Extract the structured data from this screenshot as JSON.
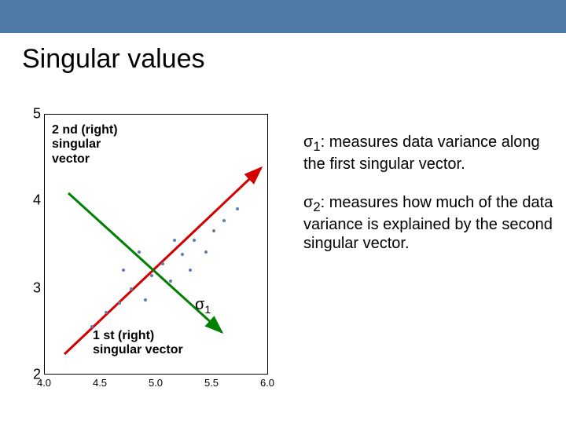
{
  "title": "Singular values",
  "plot": {
    "x_ticks": [
      "4.0",
      "4.5",
      "5.0",
      "5.5",
      "6.0"
    ],
    "y_ticks": [
      "2",
      "3",
      "4",
      "5"
    ],
    "anno_2nd": "2 nd (right) singular vector",
    "anno_1st": "1 st (right) singular vector",
    "sigma1_label": "σ",
    "sigma1_sub": "1"
  },
  "right": {
    "p1_lead": "σ",
    "p1_sub": "1",
    "p1_rest": ": measures data variance along the first singular vector.",
    "p2_lead": "σ",
    "p2_sub": "2",
    "p2_rest": ": measures how much of the data variance is explained by the second singular vector."
  },
  "chart_data": {
    "type": "line",
    "title": "Singular values",
    "xlabel": "",
    "ylabel": "",
    "xlim": [
      4.0,
      6.0
    ],
    "ylim": [
      2,
      5
    ],
    "x_ticks": [
      4.0,
      4.5,
      5.0,
      5.5,
      6.0
    ],
    "y_ticks": [
      2,
      3,
      4,
      5
    ],
    "series": [
      {
        "name": "1st (right) singular vector",
        "color": "#d40000",
        "points": [
          [
            4.05,
            2.2
          ],
          [
            5.95,
            4.4
          ]
        ]
      },
      {
        "name": "2nd (right) singular vector",
        "color": "#008000",
        "points": [
          [
            4.2,
            4.05
          ],
          [
            5.6,
            2.5
          ]
        ]
      }
    ],
    "annotations": [
      "σ1",
      "2 nd (right) singular vector",
      "1 st (right) singular vector"
    ]
  }
}
